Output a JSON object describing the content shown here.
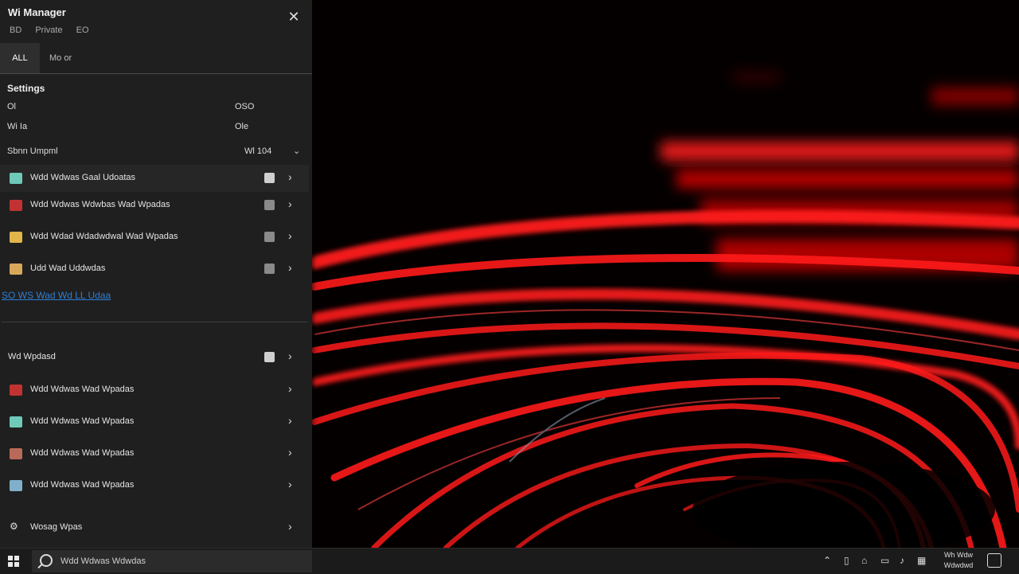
{
  "panel": {
    "title": "Wi Manager",
    "subtabs": [
      "BD",
      "Private",
      "EO"
    ],
    "tabs": {
      "first": "ALL",
      "second": "Mo or"
    },
    "settings_label": "Settings",
    "kv": [
      {
        "key": "Ol",
        "value": "OSO"
      },
      {
        "key": "Wi Ia",
        "value": "Ole"
      }
    ],
    "dropdown": {
      "label": "Sbnn Umpml",
      "value": "Wl 104"
    },
    "items_top": [
      {
        "label": "Wdd Wdwas Gaal Udoatas",
        "color": "#6fc9b9"
      },
      {
        "label": "Wdd Wdwas Wdwbas Wad Wpadas",
        "color": "#c23232"
      },
      {
        "label": "Wdd Wdad Wdadwdwal Wad Wpadas",
        "color": "#e0b64a"
      },
      {
        "label": "Udd Wad Uddwdas",
        "color": "#d8a85a"
      }
    ],
    "link_text": "SO WS Wad Wd LL Udaa",
    "section2": {
      "label": "Wd Wpdasd"
    },
    "items_bottom": [
      {
        "label": "Wdd Wdwas Wad Wpadas",
        "color": "#c23232"
      },
      {
        "label": "Wdd Wdwas Wad Wpadas",
        "color": "#6fc9b9"
      },
      {
        "label": "Wdd Wdwas Wad Wpadas",
        "color": "#b86a5a"
      },
      {
        "label": "Wdd Wdwas Wad Wpadas",
        "color": "#7fb0c9"
      }
    ],
    "footer": {
      "label": "Wosag Wpas"
    }
  },
  "taskbar": {
    "search_text": "Wdd Wdwas Wdwdas",
    "clock_line1": "Wh Wdw",
    "clock_line2": "Wdwdwd"
  },
  "colors": {
    "panel_bg": "#1f1f1f",
    "link": "#2f7fd6",
    "wallpaper_accent": "#ff1010"
  }
}
